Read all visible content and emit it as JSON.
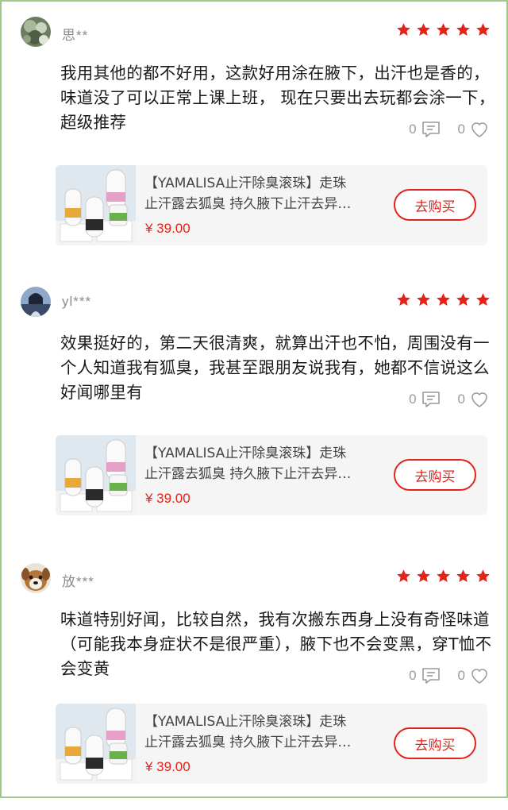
{
  "colors": {
    "star": "#e2231a",
    "price": "#e2231a",
    "border": "#9ecb8a"
  },
  "reviews": [
    {
      "username": "思**",
      "avatar_icon": "user-avatar-icon",
      "rating": 5,
      "text": "我用其他的都不好用，这款好用涂在腋下，出汗也是香的，味道没了可以正常上课上班， 现在只要出去玩都会涂一下，超级推荐",
      "comment_count": "0",
      "like_count": "0",
      "product": {
        "title_line1": "【YAMALISA止汗除臭滚珠】走珠",
        "title_line2": "止汗露去狐臭 持久腋下止汗去异…",
        "price": "¥ 39.00",
        "buy_label": "去购买"
      }
    },
    {
      "username": "yl***",
      "avatar_icon": "user-avatar-icon",
      "rating": 5,
      "text": "效果挺好的，第二天很清爽，就算出汗也不怕，周围没有一个人知道我有狐臭，我甚至跟朋友说我有，她都不信说这么好闻哪里有",
      "comment_count": "0",
      "like_count": "0",
      "product": {
        "title_line1": "【YAMALISA止汗除臭滚珠】走珠",
        "title_line2": "止汗露去狐臭 持久腋下止汗去异…",
        "price": "¥ 39.00",
        "buy_label": "去购买"
      }
    },
    {
      "username": "放***",
      "avatar_icon": "user-avatar-icon",
      "rating": 5,
      "text": "味道特别好闻，比较自然，我有次搬东西身上没有奇怪味道（可能我本身症状不是很严重），腋下也不会变黑，穿T恤不会变黄",
      "comment_count": "0",
      "like_count": "0",
      "product": {
        "title_line1": "【YAMALISA止汗除臭滚珠】走珠",
        "title_line2": "止汗露去狐臭 持久腋下止汗去异…",
        "price": "¥ 39.00",
        "buy_label": "去购买"
      }
    }
  ]
}
